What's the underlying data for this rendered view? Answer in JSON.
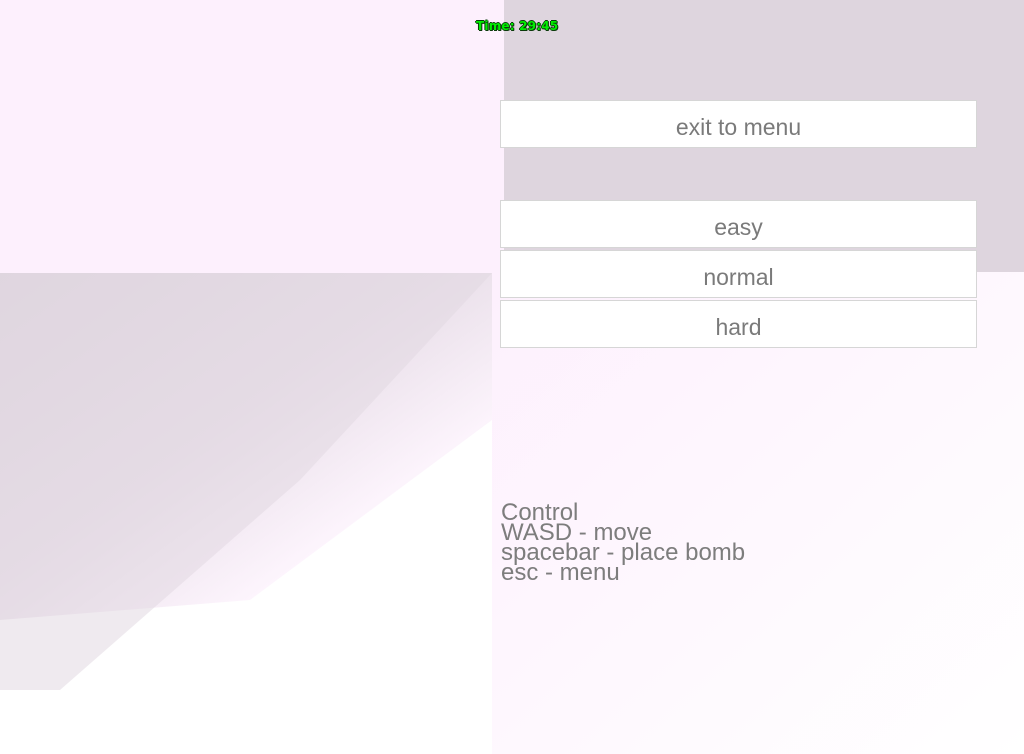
{
  "hud": {
    "timer": "Time: 29:45"
  },
  "menu": {
    "exit_label": "exit to menu",
    "difficulty": {
      "easy_label": "easy",
      "normal_label": "normal",
      "hard_label": "hard"
    }
  },
  "controls": {
    "title": "Control",
    "lines": [
      "WASD - move",
      "spacebar - place bomb",
      "esc - menu"
    ]
  },
  "colors": {
    "timer_text": "#00ee00",
    "button_bg": "#ffffff",
    "button_text": "#7a7a7a",
    "wall_light": "#fdf0fd",
    "wall_shade": "#ded5de"
  }
}
